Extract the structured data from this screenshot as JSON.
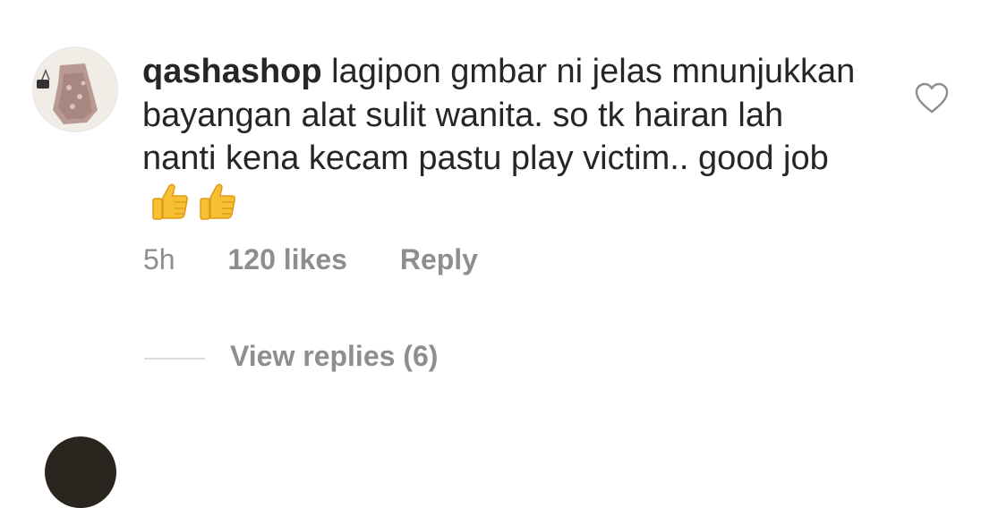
{
  "comment": {
    "username": "qashashop",
    "text": "lagipon gmbar ni jelas mnunjukkan bayangan alat sulit wanita. so tk hairan lah nanti kena kecam pastu play victim.. good job",
    "emoji": [
      "thumbs-up",
      "thumbs-up"
    ],
    "time": "5h",
    "likes": "120 likes",
    "reply_label": "Reply",
    "view_replies_label": "View replies (6)"
  },
  "icons": {
    "like": "heart-outline-icon"
  },
  "colors": {
    "text": "#262626",
    "secondary": "#8e8e8e",
    "divider": "#dbdbdb"
  }
}
